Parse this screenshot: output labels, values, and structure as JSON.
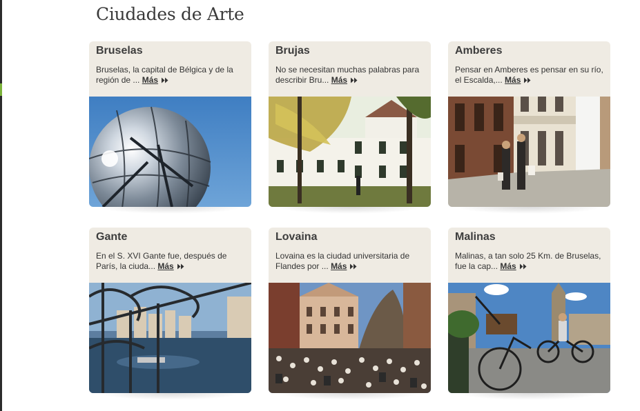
{
  "page": {
    "title": "Ciudades de Arte"
  },
  "more_label": "Más",
  "cards": [
    {
      "title": "Bruselas",
      "description": "Bruselas, la capital de Bélgica y de la región de ...",
      "more": "Más"
    },
    {
      "title": "Brujas",
      "description": "No se necesitan muchas palabras para describir Bru...",
      "more": "Más"
    },
    {
      "title": "Amberes",
      "description": "Pensar en Amberes es pensar en su río, el Escalda,...",
      "more": "Más"
    },
    {
      "title": "Gante",
      "description": "En el S. XVI Gante fue, después de París, la ciuda...",
      "more": "Más"
    },
    {
      "title": "Lovaina",
      "description": "Lovaina es la ciudad universitaria de Flandes por ...",
      "more": "Más"
    },
    {
      "title": "Malinas",
      "description": "Malinas, a tan solo 25 Km. de Bruselas, fue la cap...",
      "more": "Más"
    }
  ],
  "icons": {
    "more": "double-chevron-right-icon"
  },
  "colors": {
    "card_bg": "#efebe3",
    "title_text": "#3a3a3a",
    "rail": "#2b2b2b",
    "rail_accent": "#7bb23a"
  }
}
